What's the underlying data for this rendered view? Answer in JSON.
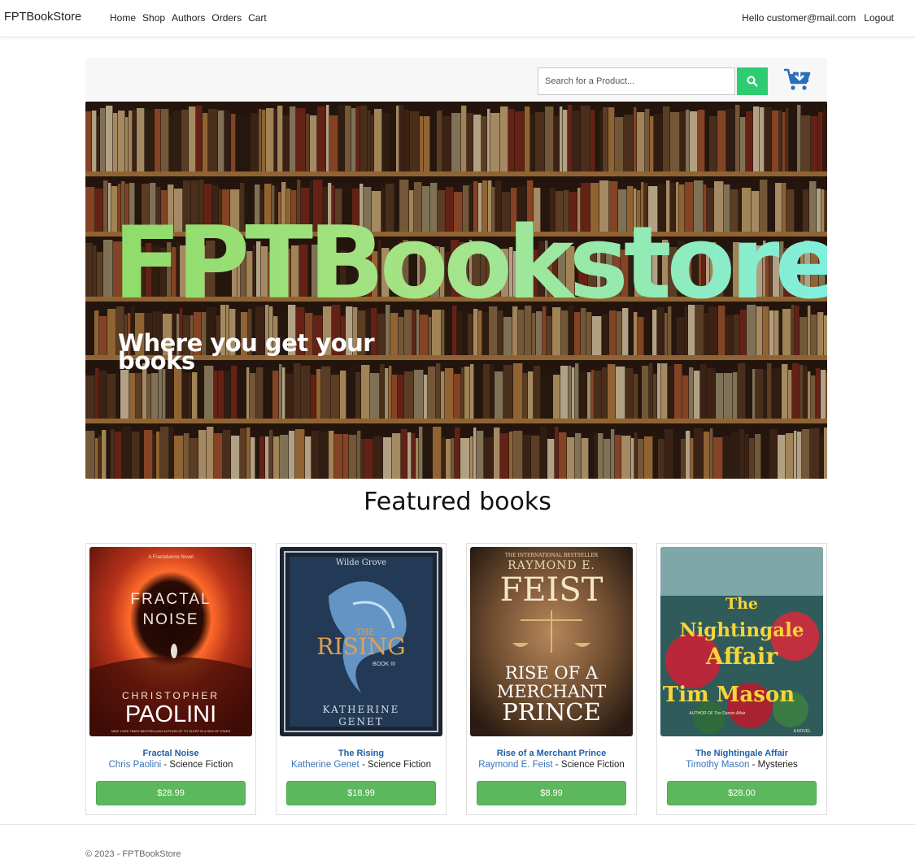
{
  "nav": {
    "brand": "FPTBookStore",
    "links": [
      "Home",
      "Shop",
      "Authors",
      "Orders",
      "Cart"
    ],
    "greeting": "Hello customer@mail.com",
    "logout": "Logout"
  },
  "search": {
    "placeholder": "Search for a Product..."
  },
  "hero": {
    "title": "FPTBookstore",
    "subtitle": "Where you get your books"
  },
  "featured": {
    "heading": "Featured books",
    "books": [
      {
        "title": "Fractal Noise",
        "author": "Chris Paolini",
        "genre": "Science Fiction",
        "price": "$28.99",
        "cover": {
          "line1": "FRACTAL",
          "line2": "NOISE",
          "small_top": "A Fractalverse Novel",
          "author_first": "CHRISTOPHER",
          "author_last": "PAOLINI",
          "tagline": "NEW YORK TIMES BESTSELLING AUTHOR OF TO SLEEP IN A SEA OF STARS"
        }
      },
      {
        "title": "The Rising",
        "author": "Katherine Genet",
        "genre": "Science Fiction",
        "price": "$18.99",
        "cover": {
          "series": "Wilde Grove",
          "line1": "THE",
          "line2": "RISING",
          "book": "BOOK III",
          "author_first": "KATHERINE",
          "author_last": "GENET"
        }
      },
      {
        "title": "Rise of a Merchant Prince",
        "author": "Raymond E. Feist",
        "genre": "Science Fiction",
        "price": "$8.99",
        "cover": {
          "small_top": "THE INTERNATIONAL BESTSELLER",
          "author_first": "RAYMOND E.",
          "author_last": "FEIST",
          "line1": "RISE OF A",
          "line2": "MERCHANT",
          "line3": "PRINCE"
        }
      },
      {
        "title": "The Nightingale Affair",
        "author": "Timothy Mason",
        "genre": "Mysteries",
        "price": "$28.00",
        "cover": {
          "line1": "The",
          "line2": "Nightingale",
          "line3": "Affair",
          "author": "Tim Mason",
          "small_bottom": "AUTHOR OF The Darwin Affair",
          "novel": "A NOVEL"
        }
      }
    ]
  },
  "footer": {
    "text": "© 2023 - FPTBookStore"
  },
  "colors": {
    "search_button": "#2ecc71",
    "price_button": "#5cb85c",
    "link_blue": "#1f5fa8",
    "cart_blue": "#2a6fb8",
    "hero_gradient_start": "#8fdc6a",
    "hero_gradient_end": "#7ff0e0"
  }
}
